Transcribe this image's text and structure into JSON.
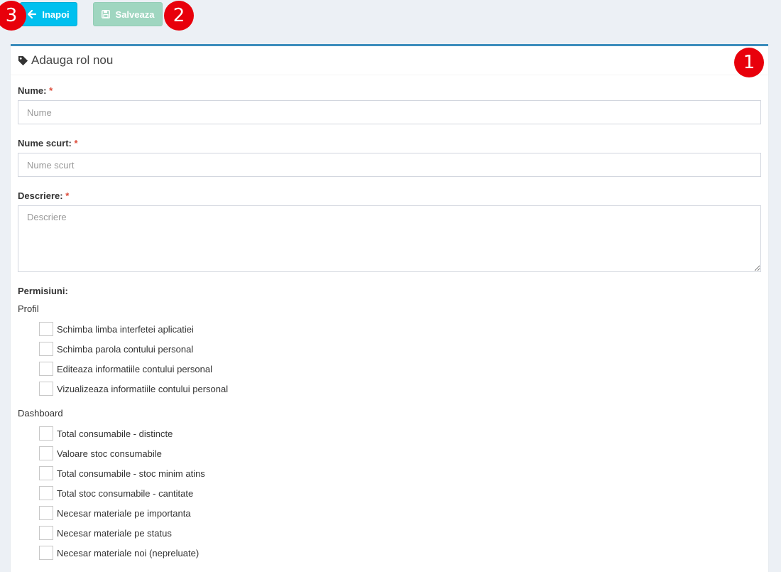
{
  "toolbar": {
    "back_label": "Inapoi",
    "save_label": "Salveaza"
  },
  "badges": [
    "1",
    "2",
    "3"
  ],
  "panel": {
    "title": "Adauga rol nou"
  },
  "form": {
    "name_label": "Nume:",
    "name_placeholder": "Nume",
    "short_name_label": "Nume scurt:",
    "short_name_placeholder": "Nume scurt",
    "description_label": "Descriere:",
    "description_placeholder": "Descriere",
    "required_mark": "*",
    "permissions_label": "Permisiuni:"
  },
  "permissions": {
    "groups": [
      {
        "title": "Profil",
        "items": [
          "Schimba limba interfetei aplicatiei",
          "Schimba parola contului personal",
          "Editeaza informatiile contului personal",
          "Vizualizeaza informatiile contului personal"
        ]
      },
      {
        "title": "Dashboard",
        "items": [
          "Total consumabile - distincte",
          "Valoare stoc consumabile",
          "Total consumabile - stoc minim atins",
          "Total stoc consumabile - cantitate",
          "Necesar materiale pe importanta",
          "Necesar materiale pe status",
          "Necesar materiale noi (nepreluate)"
        ]
      }
    ]
  },
  "colors": {
    "back_button": "#00c0ef",
    "save_button": "#9fd6c0",
    "panel_accent": "#3c8dbc",
    "badge": "#e8000b",
    "required": "#dd4b39"
  }
}
